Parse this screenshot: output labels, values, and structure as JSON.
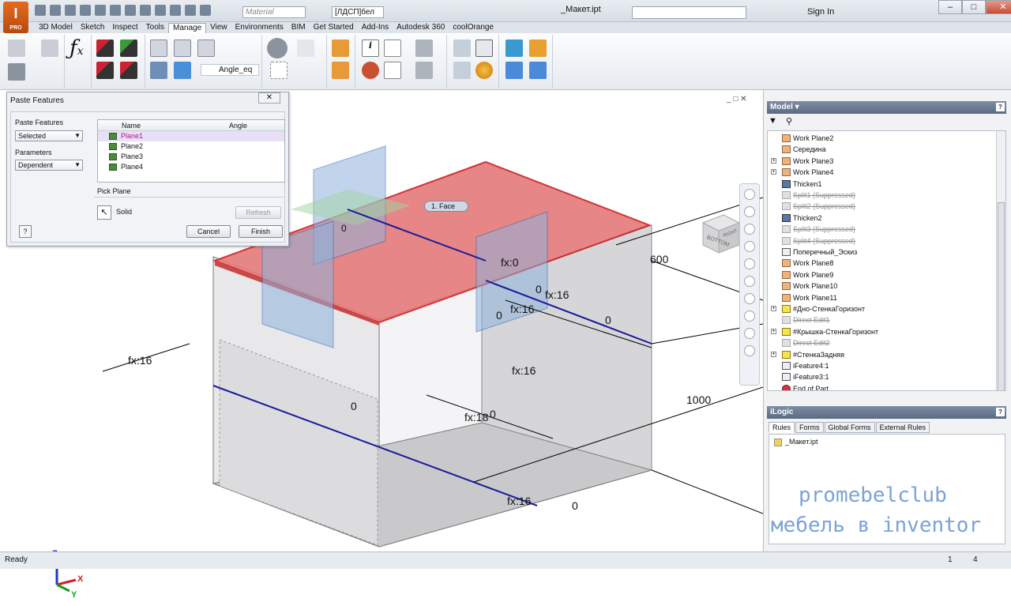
{
  "app": {
    "logo_text": "I",
    "logo_sub": "PRO",
    "title": "_Макет.ipt",
    "material_placeholder": "Material",
    "appearance_value": "[ЛДСП]бел",
    "search_placeholder": "",
    "signin": "Sign In",
    "win_min": "–",
    "win_max": "□",
    "win_close": "✕"
  },
  "menu": {
    "tabs": [
      "3D Model",
      "Sketch",
      "Inspect",
      "Tools",
      "Manage",
      "View",
      "Environments",
      "BIM",
      "Get Started",
      "Add-Ins",
      "Autodesk 360",
      "coolOrange"
    ],
    "active": "Manage"
  },
  "ribbon": {
    "angle_param": "Angle_eq"
  },
  "paste_dialog": {
    "title": "Paste Features",
    "close": "✕",
    "paste_features_label": "Paste Features",
    "paste_features_value": "Selected",
    "parameters_label": "Parameters",
    "parameters_value": "Dependent",
    "col_name": "Name",
    "col_angle": "Angle",
    "rows": [
      "Plane1",
      "Plane2",
      "Plane3",
      "Plane4"
    ],
    "pick_plane_label": "Pick Plane",
    "solid_label": "Solid",
    "refresh": "Refresh",
    "cancel": "Cancel",
    "finish": "Finish",
    "help": "?"
  },
  "model_browser": {
    "title": "Model ▾",
    "help": "?",
    "items": [
      {
        "label": "Work Plane2",
        "type": "plane",
        "exp": false
      },
      {
        "label": "Середина",
        "type": "plane",
        "exp": false
      },
      {
        "label": "Work Plane3",
        "type": "plane",
        "exp": true
      },
      {
        "label": "Work Plane4",
        "type": "plane",
        "exp": true
      },
      {
        "label": "Thicken1",
        "type": "tk",
        "exp": false
      },
      {
        "label": "Split1 (Suppressed)",
        "type": "sup",
        "exp": false
      },
      {
        "label": "Split2 (Suppressed)",
        "type": "sup",
        "exp": false
      },
      {
        "label": "Thicken2",
        "type": "tk",
        "exp": false
      },
      {
        "label": "Split3 (Suppressed)",
        "type": "sup",
        "exp": false
      },
      {
        "label": "Split4 (Suppressed)",
        "type": "sup",
        "exp": false
      },
      {
        "label": "Поперечный_Эскиз",
        "type": "feat",
        "exp": false
      },
      {
        "label": "Work Plane8",
        "type": "plane",
        "exp": false
      },
      {
        "label": "Work Plane9",
        "type": "plane",
        "exp": false
      },
      {
        "label": "Work Plane10",
        "type": "plane",
        "exp": false
      },
      {
        "label": "Work Plane11",
        "type": "plane",
        "exp": false
      },
      {
        "label": "#Дно-СтенкаГоризонт",
        "type": "fix",
        "exp": true
      },
      {
        "label": "Direct Edit1",
        "type": "sup",
        "exp": false
      },
      {
        "label": "#Крышка-СтенкаГоризонт",
        "type": "fix",
        "exp": true
      },
      {
        "label": "Direct Edit2",
        "type": "sup",
        "exp": false
      },
      {
        "label": "#СтенкаЗадняя",
        "type": "fix",
        "exp": true
      },
      {
        "label": "iFeature4:1",
        "type": "feat",
        "exp": false
      },
      {
        "label": "iFeature3:1",
        "type": "feat",
        "exp": false
      },
      {
        "label": "End of Part",
        "type": "end",
        "exp": false
      }
    ]
  },
  "ilogic": {
    "title": "iLogic",
    "help": "?",
    "tabs": [
      "Rules",
      "Forms",
      "Global Forms",
      "External Rules"
    ],
    "rule_file": "_Макет.ipt"
  },
  "watermark": {
    "line1": "promebelclub",
    "line2": "мебель в inventor"
  },
  "viewport_labels": {
    "face_tooltip": "1. Face",
    "dims": [
      "0",
      "fx:0",
      "fx:16",
      "0",
      "fx:16",
      "0",
      "0",
      "fx:16",
      "fx:16",
      "0",
      "fx:18",
      "0",
      "fx:16",
      "0",
      "600",
      "1000"
    ],
    "viewcube_face": "BOTTOM",
    "viewcube_side": "RIGHT",
    "axis_x": "X",
    "axis_y": "Y",
    "axis_z": "Z"
  },
  "status": {
    "text": "Ready",
    "n1": "1",
    "n2": "4"
  },
  "colors": {
    "accent_red": "#e06060",
    "plane_blue": "#5a8fd0",
    "edge_blue": "#1a1a9a"
  }
}
